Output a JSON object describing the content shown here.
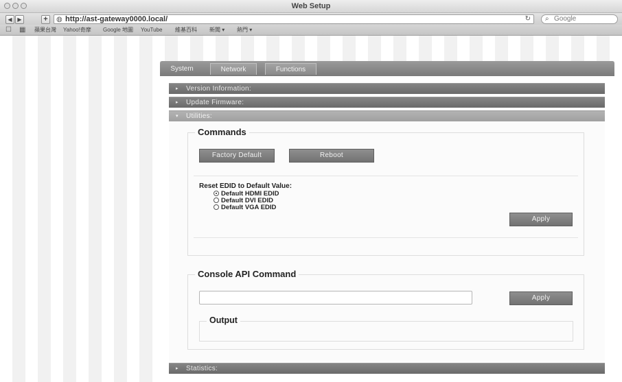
{
  "browser": {
    "window_title": "Web Setup",
    "url": "http://ast-gateway0000.local/",
    "search_placeholder": "Google",
    "bookmarks": [
      "蘋果台灣",
      "Yahoo!奇摩",
      "Google 地圖",
      "YouTube",
      "維基百科",
      "新聞 ▾",
      "熱門 ▾"
    ]
  },
  "tabs": [
    {
      "label": "System"
    },
    {
      "label": "Network"
    },
    {
      "label": "Functions"
    }
  ],
  "accordion": {
    "version": "Version Information:",
    "firmware": "Update Firmware:",
    "utilities": "Utilities:",
    "statistics": "Statistics:"
  },
  "commands": {
    "title": "Commands",
    "factory_default": "Factory Default",
    "reboot": "Reboot",
    "edid_title": "Reset EDID to Default Value:",
    "edid_options": [
      {
        "label": "Default HDMI EDID",
        "checked": true
      },
      {
        "label": "Default DVI EDID",
        "checked": false
      },
      {
        "label": "Default VGA EDID",
        "checked": false
      }
    ],
    "apply": "Apply"
  },
  "console": {
    "title": "Console API Command",
    "input_value": "",
    "apply": "Apply",
    "output_title": "Output"
  }
}
